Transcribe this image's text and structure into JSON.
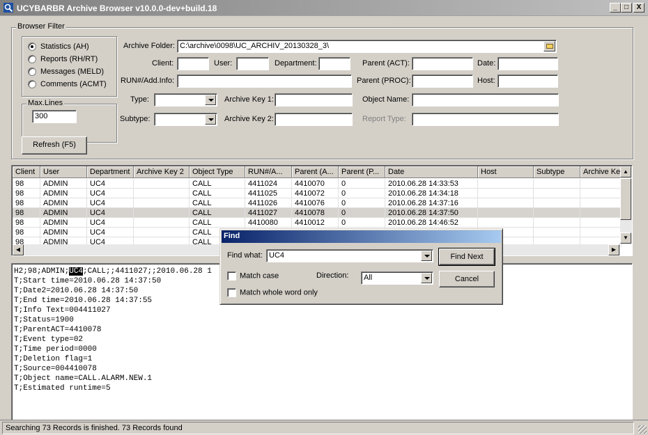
{
  "window": {
    "title": "UCYBARBR Archive Browser v10.0.0-dev+build.18",
    "minimize": "_",
    "maximize": "□",
    "close": "X"
  },
  "filter": {
    "legend": "Browser Filter",
    "radios": [
      {
        "label": "Statistics (AH)",
        "checked": true
      },
      {
        "label": "Reports (RH/RT)",
        "checked": false
      },
      {
        "label": "Messages (MELD)",
        "checked": false
      },
      {
        "label": "Comments (ACMT)",
        "checked": false
      }
    ],
    "max_lines_legend": "Max.Lines",
    "max_lines_value": "300",
    "archive_folder_label": "Archive Folder:",
    "archive_folder_value": "C:\\archive\\0098\\UC_ARCHIV_20130328_3\\",
    "client_label": "Client:",
    "user_label": "User:",
    "department_label": "Department:",
    "parent_act_label": "Parent (ACT):",
    "date_label": "Date:",
    "run_label": "RUN#/Add.Info:",
    "parent_proc_label": "Parent (PROC):",
    "host_label": "Host:",
    "type_label": "Type:",
    "archive_key1_label": "Archive Key 1:",
    "object_name_label": "Object Name:",
    "subtype_label": "Subtype:",
    "archive_key2_label": "Archive Key 2:",
    "report_type_label": "Report Type:",
    "refresh_button": "Refresh (F5)"
  },
  "grid": {
    "columns": [
      "Client",
      "User",
      "Department",
      "Archive Key 2",
      "Object Type",
      "RUN#/A...",
      "Parent (A...",
      "Parent (P...",
      "Date",
      "Host",
      "Subtype",
      "Archive Ke"
    ],
    "rows": [
      [
        "98",
        "ADMIN",
        "UC4",
        "",
        "CALL",
        "4411024",
        "4410070",
        "0",
        "2010.06.28 14:33:53",
        "",
        "",
        ""
      ],
      [
        "98",
        "ADMIN",
        "UC4",
        "",
        "CALL",
        "4411025",
        "4410072",
        "0",
        "2010.06.28 14:34:18",
        "",
        "",
        ""
      ],
      [
        "98",
        "ADMIN",
        "UC4",
        "",
        "CALL",
        "4411026",
        "4410076",
        "0",
        "2010.06.28 14:37:16",
        "",
        "",
        ""
      ],
      [
        "98",
        "ADMIN",
        "UC4",
        "",
        "CALL",
        "4411027",
        "4410078",
        "0",
        "2010.06.28 14:37:50",
        "",
        "",
        ""
      ],
      [
        "98",
        "ADMIN",
        "UC4",
        "",
        "CALL",
        "4410080",
        "4410012",
        "0",
        "2010.06.28 14:46:52",
        "",
        "",
        ""
      ],
      [
        "98",
        "ADMIN",
        "UC4",
        "",
        "CALL",
        "",
        "",
        "",
        "",
        "",
        "",
        ""
      ],
      [
        "98",
        "ADMIN",
        "UC4",
        "",
        "CALL",
        "",
        "",
        "",
        "",
        "",
        "",
        ""
      ]
    ],
    "selected_row": 3
  },
  "detail": {
    "first_line": {
      "before": "H2;98;ADMIN;",
      "highlight": "UC4",
      "after": ";CALL;;4411027;;2010.06.28 1"
    },
    "lines": [
      "T;Start time=2010.06.28 14:37:50",
      "T;Date2=2010.06.28 14:37:50",
      "T;End time=2010.06.28 14:37:55",
      "T;Info Text=004411027",
      "T;Status=1900",
      "T;ParentACT=4410078",
      "T;Event type=02",
      "T;Time period=0000",
      "T;Deletion flag=1",
      "T;Source=004410078",
      "T;Object name=CALL.ALARM.NEW.1",
      "T;Estimated runtime=5"
    ]
  },
  "find_dialog": {
    "title": "Find",
    "find_what_label": "Find what:",
    "find_what_value": "UC4",
    "match_case_label": "Match case",
    "match_case_checked": false,
    "whole_word_label": "Match whole word only",
    "whole_word_checked": false,
    "direction_label": "Direction:",
    "direction_value": "All",
    "find_next_button": "Find Next",
    "cancel_button": "Cancel"
  },
  "status": {
    "text": "Searching 73 Records is finished. 73 Records found"
  }
}
